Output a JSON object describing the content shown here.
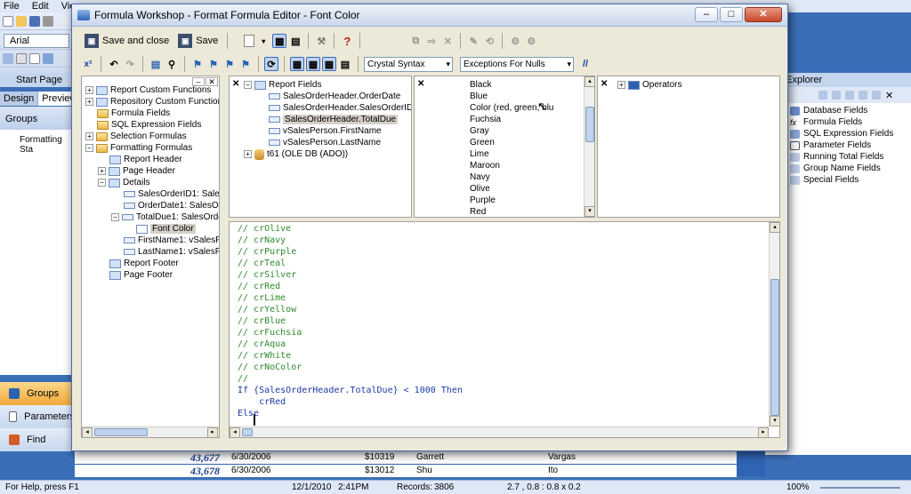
{
  "background": {
    "menu": [
      "File",
      "Edit",
      "View"
    ],
    "font_value": "Arial",
    "start_page_tab": "Start Page",
    "tabs": [
      "Design",
      "Preview"
    ],
    "groups_header": "Groups",
    "groups_item": "Formatting Sta",
    "nav": {
      "groups": "Groups",
      "parameters": "Parameters",
      "find": "Find"
    },
    "field_explorer": {
      "title": "d Explorer",
      "items": [
        "Database Fields",
        "Formula Fields",
        "SQL Expression Fields",
        "Parameter Fields",
        "Running Total Fields",
        "Group Name Fields",
        "Special Fields"
      ]
    },
    "rows": [
      {
        "num": "43,677",
        "date": "6/30/2006",
        "amount": "$10319",
        "first": "Garrett",
        "last": "Vargas"
      },
      {
        "num": "43,678",
        "date": "6/30/2006",
        "amount": "$13012",
        "first": "Shu",
        "last": "Ito"
      }
    ],
    "status": {
      "help": "For Help, press F1",
      "date": "12/1/2010",
      "time": "2:41PM",
      "records": "Records:",
      "records_count": "3806",
      "coords": "2.7 , 0.8 : 0.8 x 0.2",
      "zoom": "100%"
    }
  },
  "dialog": {
    "title": "Formula Workshop - Format Formula Editor - Font Color",
    "buttons": {
      "save_and_close": "Save and close",
      "save": "Save"
    },
    "syntax_value": "Crystal Syntax",
    "nulls_value": "Exceptions For Nulls",
    "comment_button": "//",
    "workshop_tree": [
      {
        "label": "Report Custom Functions",
        "level": 0
      },
      {
        "label": "Repository Custom Functions",
        "level": 0
      },
      {
        "label": "Formula Fields",
        "level": 0
      },
      {
        "label": "SQL Expression Fields",
        "level": 0
      },
      {
        "label": "Selection Formulas",
        "level": 0
      },
      {
        "label": "Formatting Formulas",
        "level": 0
      },
      {
        "label": "Report Header",
        "level": 1
      },
      {
        "label": "Page Header",
        "level": 1
      },
      {
        "label": "Details",
        "level": 1
      },
      {
        "label": "SalesOrderID1: SalesC",
        "level": 2
      },
      {
        "label": "OrderDate1: SalesOrde",
        "level": 2
      },
      {
        "label": "TotalDue1: SalesOrder",
        "level": 2
      },
      {
        "label": "Font Color",
        "level": 3
      },
      {
        "label": "FirstName1: vSalesPer",
        "level": 2
      },
      {
        "label": "LastName1: vSalesPer",
        "level": 2
      },
      {
        "label": "Report Footer",
        "level": 1
      },
      {
        "label": "Page Footer",
        "level": 1
      }
    ],
    "report_fields": {
      "root": "Report Fields",
      "items": [
        "SalesOrderHeader.OrderDate",
        "SalesOrderHeader.SalesOrderID",
        "SalesOrderHeader.TotalDue",
        "vSalesPerson.FirstName",
        "vSalesPerson.LastName"
      ],
      "db": "t61 (OLE DB (ADO))"
    },
    "functions": [
      "Black",
      "Blue",
      "Color (red, green, blu",
      "Fuchsia",
      "Gray",
      "Green",
      "Lime",
      "Maroon",
      "Navy",
      "Olive",
      "Purple",
      "Red"
    ],
    "operators_root": "Operators",
    "code": [
      "// crOlive",
      "// crNavy",
      "// crPurple",
      "// crTeal",
      "// crSilver",
      "// crRed",
      "// crLime",
      "// crYellow",
      "// crBlue",
      "// crFuchsia",
      "// crAqua",
      "// crWhite",
      "// crNoColor",
      "//",
      "If {SalesOrderHeader.TotalDue} < 1000 Then",
      "    crRed",
      "Else"
    ]
  },
  "colors": {
    "accent": "#316ac5",
    "comment": "#2f8a2f",
    "keyword": "#1a3aa8",
    "report_band": "#2f64b4"
  }
}
